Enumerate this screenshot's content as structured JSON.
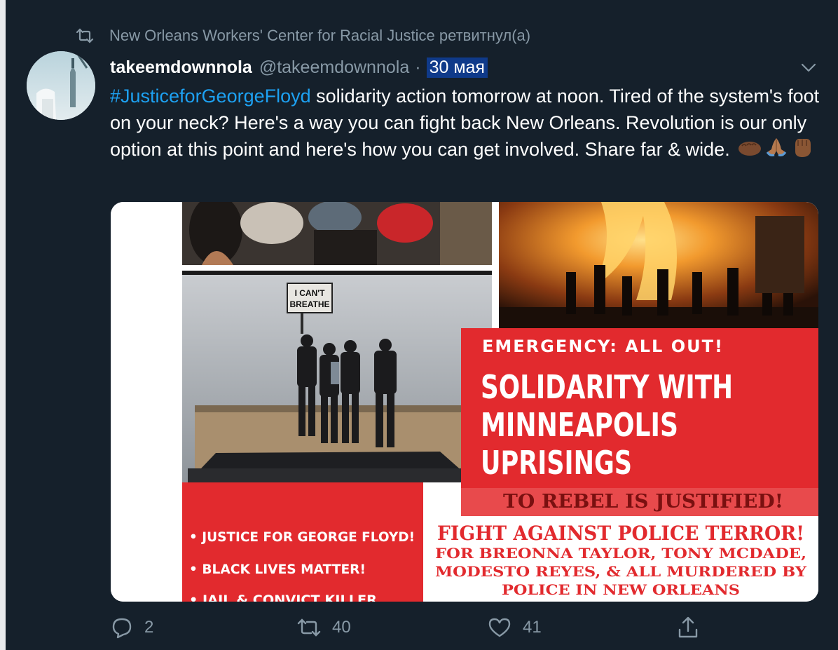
{
  "retweet": {
    "text": "New Orleans Workers' Center for Racial Justice ретвитнул(а)"
  },
  "tweet": {
    "display_name": "takeemdownnola",
    "handle": "@takeemdownnola",
    "separator": "·",
    "date": "30 мая",
    "hashtag": "#JusticeforGeorgeFloyd",
    "text": " solidarity action tomorrow at noon. Tired of the system's foot on your neck? Here's a way you can fight back New Orleans. Revolution is our only option at this point and here's how you can get involved. Share far & wide. "
  },
  "poster": {
    "sign_text": "I CAN'T BREATHE",
    "emergency": "EMERGENCY: ALL OUT!",
    "headline_1": "SOLIDARITY WITH",
    "headline_2": "MINNEAPOLIS",
    "headline_3": "UPRISINGS",
    "slogan": "TO REBEL IS JUSTIFIED!",
    "bullets": [
      "• JUSTICE FOR GEORGE FLOYD!",
      "• BLACK LIVES MATTER!",
      "• JAIL & CONVICT KILLER"
    ],
    "fight": "FIGHT AGAINST POLICE TERROR!",
    "names_1": "FOR BREONNA TAYLOR, TONY MCDADE,",
    "names_2": "MODESTO REYES, & ALL MURDERED BY",
    "names_3": "POLICE IN NEW ORLEANS"
  },
  "actions": {
    "replies": "2",
    "retweets": "40",
    "likes": "41"
  },
  "icons": {
    "retweet": "retweet-icon",
    "chevron": "chevron-down-icon",
    "reply": "reply-icon",
    "like": "heart-icon",
    "share": "share-icon"
  },
  "colors": {
    "background": "#15202b",
    "muted": "#8899a6",
    "link": "#1da1f2",
    "date_highlight": "#0f3a8a",
    "poster_red": "#e8262b"
  }
}
